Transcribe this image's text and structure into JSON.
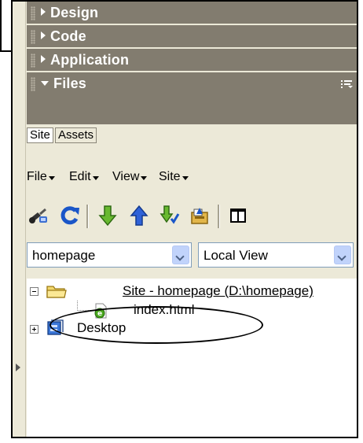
{
  "panels": [
    {
      "label": "Design",
      "expanded": false
    },
    {
      "label": "Code",
      "expanded": false
    },
    {
      "label": "Application",
      "expanded": false
    },
    {
      "label": "Files",
      "expanded": true
    }
  ],
  "files_panel": {
    "tabs": [
      "Site",
      "Assets"
    ],
    "active_tab": "Site",
    "menu": [
      "File",
      "Edit",
      "View",
      "Site"
    ],
    "toolbar_icons": [
      "connect-icon",
      "refresh-icon",
      "get-files-icon",
      "put-files-icon",
      "check-out-icon",
      "check-in-icon",
      "expand-panel-icon"
    ],
    "site_select": {
      "value": "homepage"
    },
    "view_select": {
      "value": "Local View"
    },
    "tree": {
      "root": {
        "label": "Site - homepage (D:\\homepage)",
        "icon": "folder-icon",
        "expanded": true
      },
      "files": [
        {
          "label": "index.html",
          "icon": "html-file-icon"
        }
      ],
      "other": [
        {
          "label": "Desktop",
          "icon": "desktop-icon",
          "expanded": false
        }
      ]
    }
  },
  "colors": {
    "panel_header": "#827c6f",
    "panel_background": "#ece9d8",
    "select_button": "#c1d3fb"
  }
}
